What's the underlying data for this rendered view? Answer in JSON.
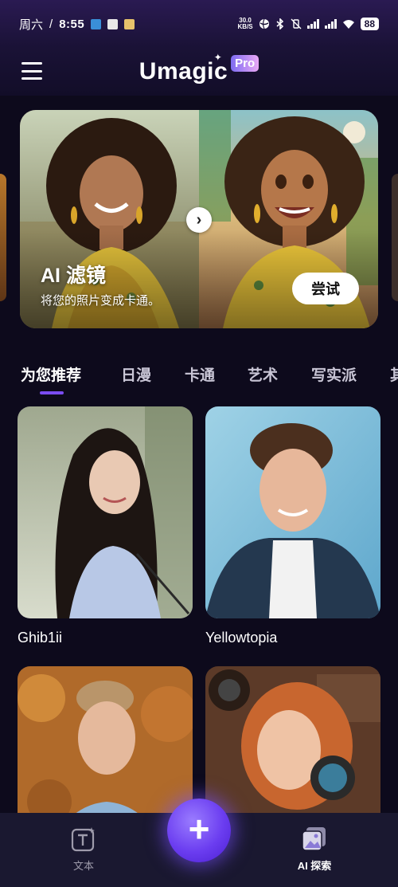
{
  "status_bar": {
    "day": "周六",
    "separator": "/",
    "time": "8:55",
    "net_speed_value": "30.0",
    "net_speed_unit": "KB/S",
    "battery": "88"
  },
  "header": {
    "logo_text": "Umagic",
    "logo_badge": "Pro"
  },
  "hero": {
    "title": "AI 滤镜",
    "subtitle": "将您的照片变成卡通。",
    "cta_label": "尝试"
  },
  "tabs": [
    {
      "label": "为您推荐",
      "active": true
    },
    {
      "label": "日漫",
      "active": false
    },
    {
      "label": "卡通",
      "active": false
    },
    {
      "label": "艺术",
      "active": false
    },
    {
      "label": "写实派",
      "active": false
    },
    {
      "label": "其",
      "active": false
    }
  ],
  "cards": [
    {
      "label": "Ghib1ii"
    },
    {
      "label": "Yellowtopia"
    },
    {
      "label": ""
    },
    {
      "label": ""
    }
  ],
  "bottom_nav": {
    "left_label": "文本",
    "right_label": "AI 探索",
    "fab_symbol": "+"
  },
  "colors": {
    "background": "#0d0a1c",
    "accent": "#7b4cf2",
    "nav_bg": "#1a1830"
  }
}
